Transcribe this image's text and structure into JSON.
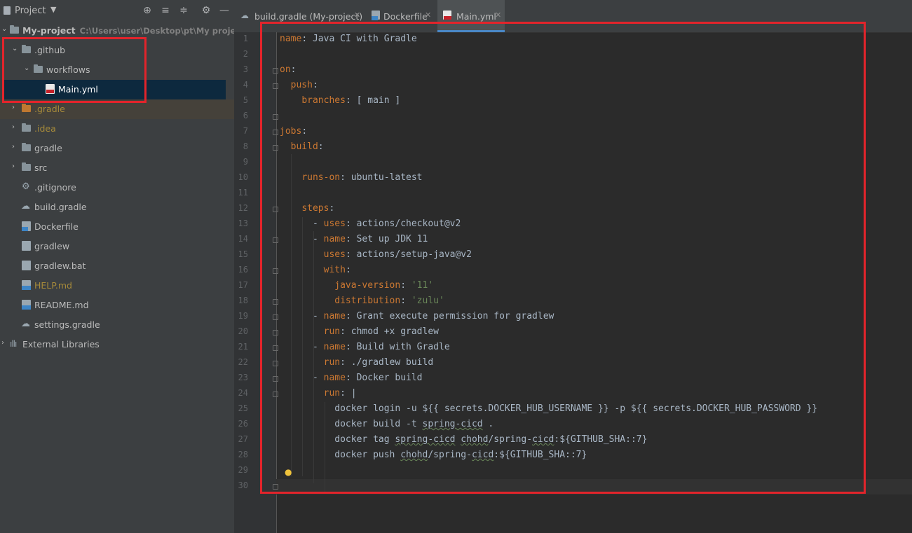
{
  "sidebar": {
    "title": "Project",
    "tree": [
      {
        "label": "My-project",
        "hint": "C:\\Users\\user\\Desktop\\pt\\My project\\M"
      },
      {
        "label": ".github"
      },
      {
        "label": "workflows"
      },
      {
        "label": "Main.yml"
      },
      {
        "label": ".gradle"
      },
      {
        "label": ".idea"
      },
      {
        "label": "gradle"
      },
      {
        "label": "src"
      },
      {
        "label": ".gitignore"
      },
      {
        "label": "build.gradle"
      },
      {
        "label": "Dockerfile"
      },
      {
        "label": "gradlew"
      },
      {
        "label": "gradlew.bat"
      },
      {
        "label": "HELP.md"
      },
      {
        "label": "README.md"
      },
      {
        "label": "settings.gradle"
      },
      {
        "label": "External Libraries"
      }
    ]
  },
  "tabs": [
    {
      "label": "build.gradle (My-project)"
    },
    {
      "label": "Dockerfile"
    },
    {
      "label": "Main.yml"
    }
  ],
  "editor": {
    "lines": [
      {
        "n": "1"
      },
      {
        "n": "2"
      },
      {
        "n": "3"
      },
      {
        "n": "4"
      },
      {
        "n": "5"
      },
      {
        "n": "6"
      },
      {
        "n": "7"
      },
      {
        "n": "8"
      },
      {
        "n": "9"
      },
      {
        "n": "10"
      },
      {
        "n": "11"
      },
      {
        "n": "12"
      },
      {
        "n": "13"
      },
      {
        "n": "14"
      },
      {
        "n": "15"
      },
      {
        "n": "16"
      },
      {
        "n": "17"
      },
      {
        "n": "18"
      },
      {
        "n": "19"
      },
      {
        "n": "20"
      },
      {
        "n": "21"
      },
      {
        "n": "22"
      },
      {
        "n": "23"
      },
      {
        "n": "24"
      },
      {
        "n": "25"
      },
      {
        "n": "26"
      },
      {
        "n": "27"
      },
      {
        "n": "28"
      },
      {
        "n": "29"
      },
      {
        "n": "30"
      }
    ],
    "code": {
      "l1k": "name",
      "l1v": "Java CI with Gradle",
      "l3k": "on",
      "l4k": "push",
      "l5k": "branches",
      "l5v": "[ main ]",
      "l7k": "jobs",
      "l8k": "build",
      "l10k": "runs-on",
      "l10v": "ubuntu-latest",
      "l12k": "steps",
      "l13k": "uses",
      "l13v": "actions/checkout@v2",
      "l14k": "name",
      "l14v": "Set up JDK 11",
      "l15k": "uses",
      "l15v": "actions/setup-java@v2",
      "l16k": "with",
      "l17k": "java-version",
      "l17v": "'11'",
      "l18k": "distribution",
      "l18v": "'zulu'",
      "l19k": "name",
      "l19v": "Grant execute permission for gradlew",
      "l20k": "run",
      "l20v": "chmod +x gradlew",
      "l21k": "name",
      "l21v": "Build with Gradle",
      "l22k": "run",
      "l22v": "./gradlew build",
      "l23k": "name",
      "l23v": "Docker build",
      "l24k": "run",
      "l24v": "|",
      "l25": "docker login -u ${{ secrets.DOCKER_HUB_USERNAME }} -p ${{ secrets.DOCKER_HUB_PASSWORD }}",
      "l26a": "docker build -t ",
      "l26b": "spring-cicd",
      "l26c": " .",
      "l27a": "docker tag ",
      "l27b": "spring-cicd",
      "l27c": " ",
      "l27d": "chohd",
      "l27e": "/spring-",
      "l27f": "cicd",
      "l27g": ":${GITHUB_SHA::7}",
      "l28a": "docker push ",
      "l28d": "chohd",
      "l28e": "/spring-",
      "l28f": "cicd",
      "l28g": ":${GITHUB_SHA::7}"
    }
  },
  "colors": {
    "highlight": "#e3242b",
    "key": "#cc7832",
    "string": "#6a8759"
  }
}
